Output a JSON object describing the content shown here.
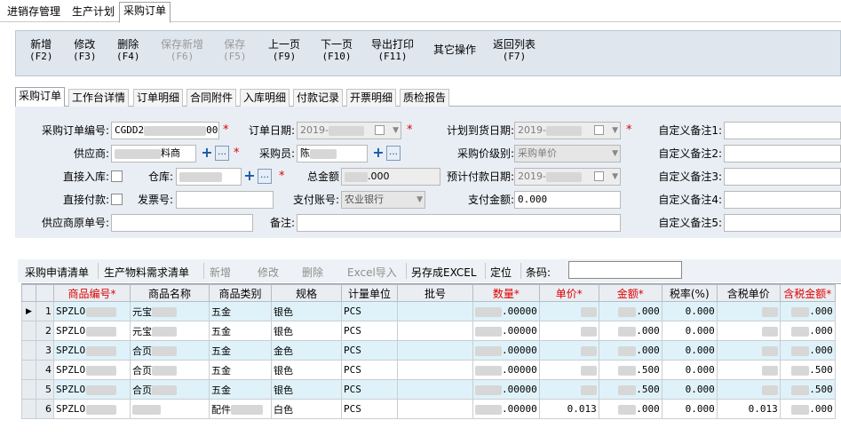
{
  "top_tabs": [
    "进销存管理",
    "生产计划",
    "采购订单"
  ],
  "toolbar": [
    {
      "label": "新增",
      "key": "(F2)",
      "enabled": true
    },
    {
      "label": "修改",
      "key": "(F3)",
      "enabled": true
    },
    {
      "label": "删除",
      "key": "(F4)",
      "enabled": true
    },
    {
      "label": "保存新增",
      "key": "(F6)",
      "enabled": false
    },
    {
      "label": "保存",
      "key": "(F5)",
      "enabled": false
    },
    {
      "label": "上一页",
      "key": "(F9)",
      "enabled": true
    },
    {
      "label": "下一页",
      "key": "(F10)",
      "enabled": true
    },
    {
      "label": "导出打印",
      "key": "(F11)",
      "enabled": true
    },
    {
      "label": "其它操作",
      "key": "",
      "enabled": true
    },
    {
      "label": "返回列表",
      "key": "(F7)",
      "enabled": true
    }
  ],
  "form_tabs": [
    "采购订单",
    "工作台详情",
    "订单明细",
    "合同附件",
    "入库明细",
    "付款记录",
    "开票明细",
    "质检报告"
  ],
  "form": {
    "order_no_label": "采购订单编号:",
    "order_no_prefix": "CGDD2",
    "order_no_suffix": "009",
    "order_date_label": "订单日期:",
    "order_date_prefix": "2019-",
    "plan_date_label": "计划到货日期:",
    "plan_date_prefix": "2019-",
    "remark1_label": "自定义备注1:",
    "supplier_label": "供应商:",
    "supplier_tail": "料商",
    "purchaser_label": "采购员:",
    "purchaser_initial": "陈",
    "price_level_label": "采购价级别:",
    "price_level_value": "采购单价",
    "remark2_label": "自定义备注2:",
    "direct_in_label": "直接入库:",
    "warehouse_label": "仓库:",
    "total_label": "总金额",
    "total_suffix": ".000",
    "pay_date_label": "预计付款日期:",
    "pay_date_prefix": "2019-",
    "remark3_label": "自定义备注3:",
    "direct_pay_label": "直接付款:",
    "invoice_label": "发票号:",
    "account_label": "支付账号:",
    "account_value": "农业银行",
    "pay_amount_label": "支付金额:",
    "pay_amount_value": "0.000",
    "remark4_label": "自定义备注4:",
    "supplier_orig_label": "供应商原单号:",
    "note_label": "备注:",
    "remark5_label": "自定义备注5:"
  },
  "grid_toolbar": {
    "items": [
      {
        "label": "采购申请清单",
        "enabled": true
      },
      {
        "label": "生产物料需求清单",
        "enabled": true
      },
      {
        "label": "新增",
        "enabled": false
      },
      {
        "label": "修改",
        "enabled": false
      },
      {
        "label": "删除",
        "enabled": false
      },
      {
        "label": "Excel导入",
        "enabled": false
      },
      {
        "label": "另存成EXCEL",
        "enabled": true
      },
      {
        "label": "定位",
        "enabled": true
      }
    ],
    "barcode_label": "条码:"
  },
  "grid": {
    "columns": [
      {
        "label": "商品编号",
        "required": true
      },
      {
        "label": "商品名称",
        "required": false
      },
      {
        "label": "商品类别",
        "required": false
      },
      {
        "label": "规格",
        "required": false
      },
      {
        "label": "计量单位",
        "required": false
      },
      {
        "label": "批号",
        "required": false
      },
      {
        "label": "数量",
        "required": true
      },
      {
        "label": "单价",
        "required": true
      },
      {
        "label": "金额",
        "required": true
      },
      {
        "label": "税率(%)",
        "required": false
      },
      {
        "label": "含税单价",
        "required": false
      },
      {
        "label": "含税金额",
        "required": true
      }
    ],
    "rows": [
      {
        "no": "1",
        "code": "SPZLO",
        "name": "元宝",
        "category": "五金",
        "spec": "银色",
        "unit": "PCS",
        "qty": ".00000",
        "price": "",
        "amount": ".000",
        "tax": "0.000",
        "tax_price": "",
        "tax_amount": ".000",
        "current": true
      },
      {
        "no": "2",
        "code": "SPZLO",
        "name": "元宝",
        "category": "五金",
        "spec": "银色",
        "unit": "PCS",
        "qty": ".00000",
        "price": "",
        "amount": ".000",
        "tax": "0.000",
        "tax_price": "",
        "tax_amount": ".000",
        "current": false
      },
      {
        "no": "3",
        "code": "SPZLO",
        "name": "合页",
        "category": "五金",
        "spec": "金色",
        "unit": "PCS",
        "qty": ".00000",
        "price": "",
        "amount": ".000",
        "tax": "0.000",
        "tax_price": "",
        "tax_amount": ".000",
        "current": false
      },
      {
        "no": "4",
        "code": "SPZLO",
        "name": "合页",
        "category": "五金",
        "spec": "银色",
        "unit": "PCS",
        "qty": ".00000",
        "price": "",
        "amount": ".500",
        "tax": "0.000",
        "tax_price": "",
        "tax_amount": ".500",
        "current": false
      },
      {
        "no": "5",
        "code": "SPZLO",
        "name": "合页",
        "category": "五金",
        "spec": "银色",
        "unit": "PCS",
        "qty": ".00000",
        "price": "",
        "amount": ".500",
        "tax": "0.000",
        "tax_price": "",
        "tax_amount": ".500",
        "current": false
      },
      {
        "no": "6",
        "code": "SPZLO",
        "name": "",
        "category": "配件",
        "spec": "白色",
        "unit": "PCS",
        "qty": ".00000",
        "price": "0.013",
        "amount": ".000",
        "tax": "0.000",
        "tax_price": "0.013",
        "tax_amount": ".000",
        "current": false
      }
    ]
  }
}
